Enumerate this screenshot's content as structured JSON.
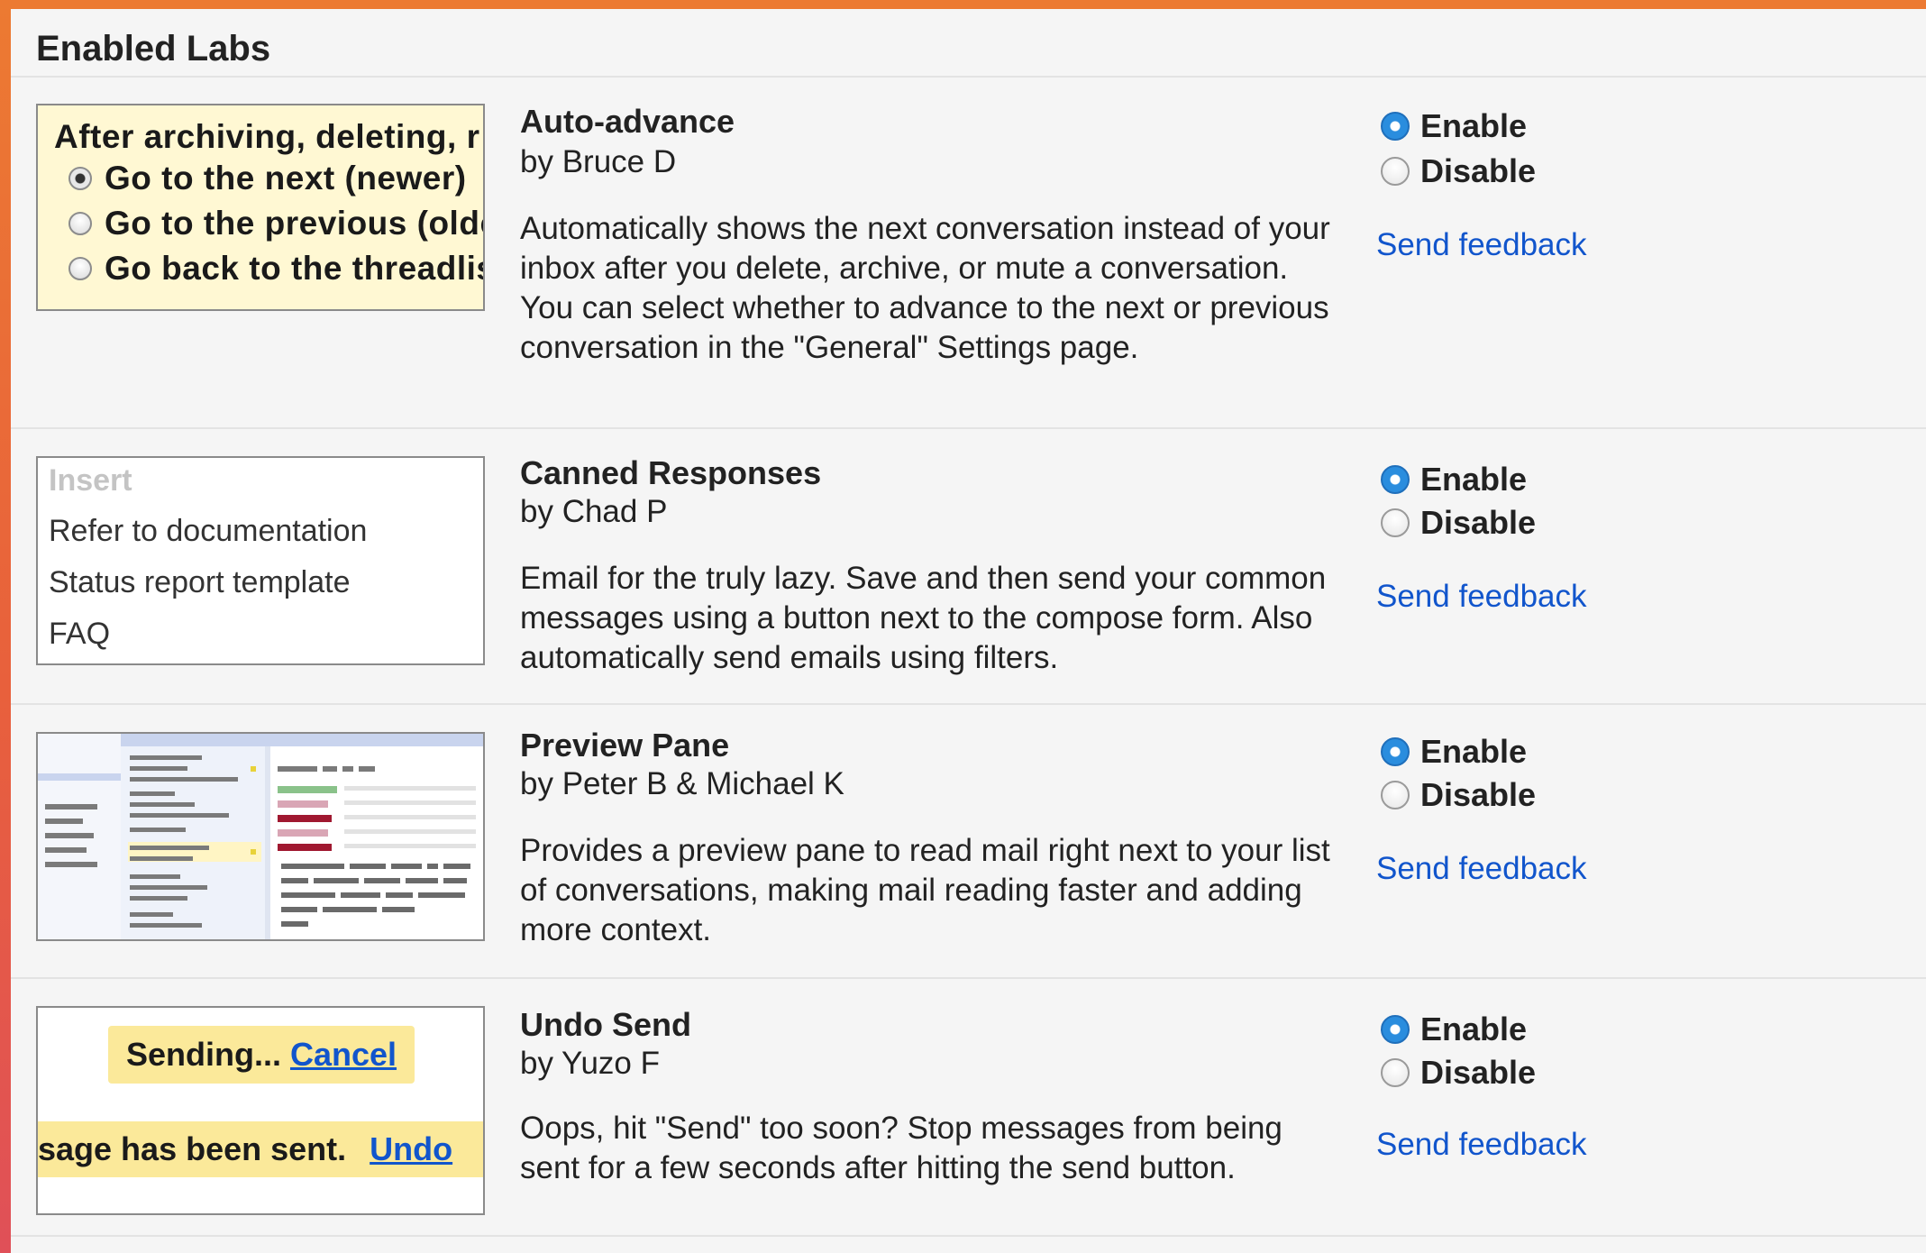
{
  "section_title": "Enabled Labs",
  "labs": [
    {
      "name": "Auto-advance",
      "author": "by Bruce D",
      "description": "Automatically shows the next conversation instead of your inbox after you delete, archive, or mute a conversation. You can select whether to advance to the next or previous conversation in the \"General\" Settings page.",
      "enable_label": "Enable",
      "disable_label": "Disable",
      "selected": "enable",
      "feedback_label": "Send feedback",
      "preview": {
        "title": "After archiving, deleting, r",
        "options": [
          "Go to the next (newer)",
          "Go to the previous (olde",
          "Go back to the threadlis"
        ],
        "selected_index": 0
      }
    },
    {
      "name": "Canned Responses",
      "author": "by Chad P",
      "description": "Email for the truly lazy. Save and then send your common messages using a button next to the compose form. Also automatically send emails using filters.",
      "enable_label": "Enable",
      "disable_label": "Disable",
      "selected": "enable",
      "feedback_label": "Send feedback",
      "preview": {
        "header": "Insert",
        "items": [
          "Refer to documentation",
          "Status report template",
          "FAQ"
        ]
      }
    },
    {
      "name": "Preview Pane",
      "author": "by Peter B & Michael K",
      "description": "Provides a preview pane to read mail right next to your list of conversations, making mail reading faster and adding more context.",
      "enable_label": "Enable",
      "disable_label": "Disable",
      "selected": "enable",
      "feedback_label": "Send feedback"
    },
    {
      "name": "Undo Send",
      "author": "by Yuzo F",
      "description": "Oops, hit \"Send\" too soon? Stop messages from being sent for a few seconds after hitting the send button.",
      "enable_label": "Enable",
      "disable_label": "Disable",
      "selected": "enable",
      "feedback_label": "Send feedback",
      "preview": {
        "sending_text": "Sending...",
        "cancel_link": "Cancel",
        "sent_text": "sage has been sent.",
        "undo_link": "Undo"
      }
    }
  ],
  "colors": {
    "link": "#1155cc",
    "radio_selected": "#2a8dde",
    "preview_highlight": "#fbe99a",
    "frame_gradient_top": "#ec7a32",
    "frame_gradient_bottom": "#e05058"
  }
}
